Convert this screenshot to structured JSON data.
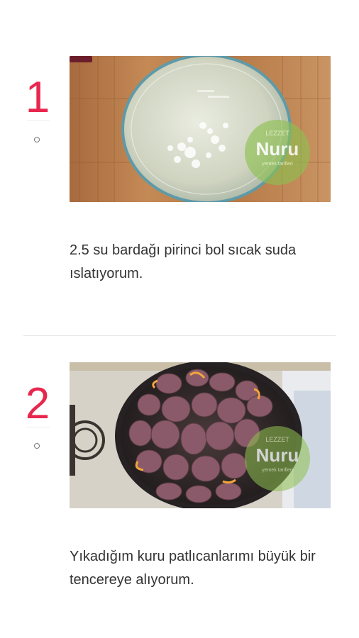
{
  "steps": [
    {
      "number": "1",
      "text": "2.5 su bardağı pirinci bol sıcak suda ıslatıyorum.",
      "watermark": {
        "top": "LEZZET",
        "main": "Nuru",
        "sub": "yemek tarifleri"
      }
    },
    {
      "number": "2",
      "text": "Yıkadığım kuru patlıcanlarımı büyük bir tencereye alıyorum.",
      "watermark": {
        "top": "LEZZET",
        "main": "Nuru",
        "sub": "yemek tarifleri"
      }
    }
  ],
  "colors": {
    "step_number": "#e8274f",
    "body_text": "#333333",
    "watermark_green": "#7fbf3f"
  }
}
